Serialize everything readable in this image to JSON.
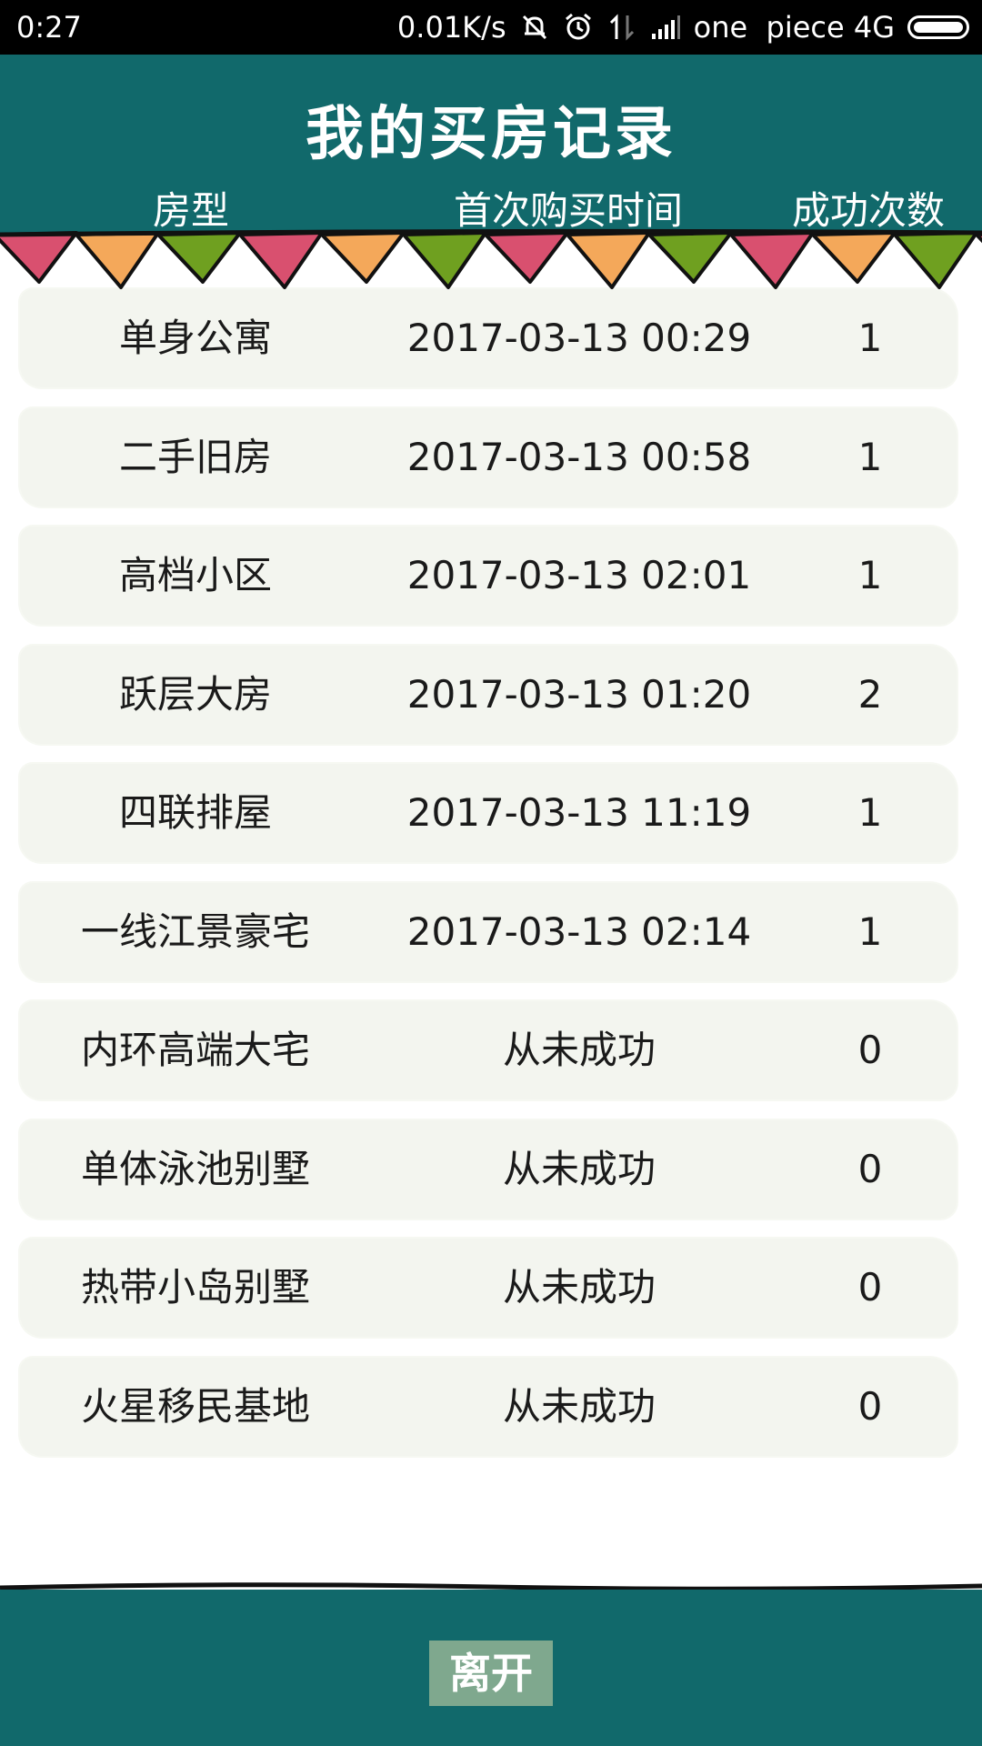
{
  "status_bar": {
    "time": "0:27",
    "speed": "0.01K/s",
    "carrier": "one  piece 4G"
  },
  "header": {
    "title": "我的买房记录",
    "columns": [
      "房型",
      "首次购买时间",
      "成功次数"
    ]
  },
  "records": [
    {
      "type": "单身公寓",
      "time": "2017-03-13 00:29",
      "count": "1"
    },
    {
      "type": "二手旧房",
      "time": "2017-03-13 00:58",
      "count": "1"
    },
    {
      "type": "高档小区",
      "time": "2017-03-13 02:01",
      "count": "1"
    },
    {
      "type": "跃层大房",
      "time": "2017-03-13 01:20",
      "count": "2"
    },
    {
      "type": "四联排屋",
      "time": "2017-03-13 11:19",
      "count": "1"
    },
    {
      "type": "一线江景豪宅",
      "time": "2017-03-13 02:14",
      "count": "1"
    },
    {
      "type": "内环高端大宅",
      "time": "从未成功",
      "count": "0"
    },
    {
      "type": "单体泳池别墅",
      "time": "从未成功",
      "count": "0"
    },
    {
      "type": "热带小岛别墅",
      "time": "从未成功",
      "count": "0"
    },
    {
      "type": "火星移民基地",
      "time": "从未成功",
      "count": "0"
    }
  ],
  "footer": {
    "leave_label": "离开"
  },
  "colors": {
    "header_bg": "#11696b",
    "row_bg": "#f3f5ef",
    "button_bg": "#7fa88e",
    "flag_pink": "#d9506f",
    "flag_orange": "#f4a85a",
    "flag_green": "#6fa020"
  }
}
